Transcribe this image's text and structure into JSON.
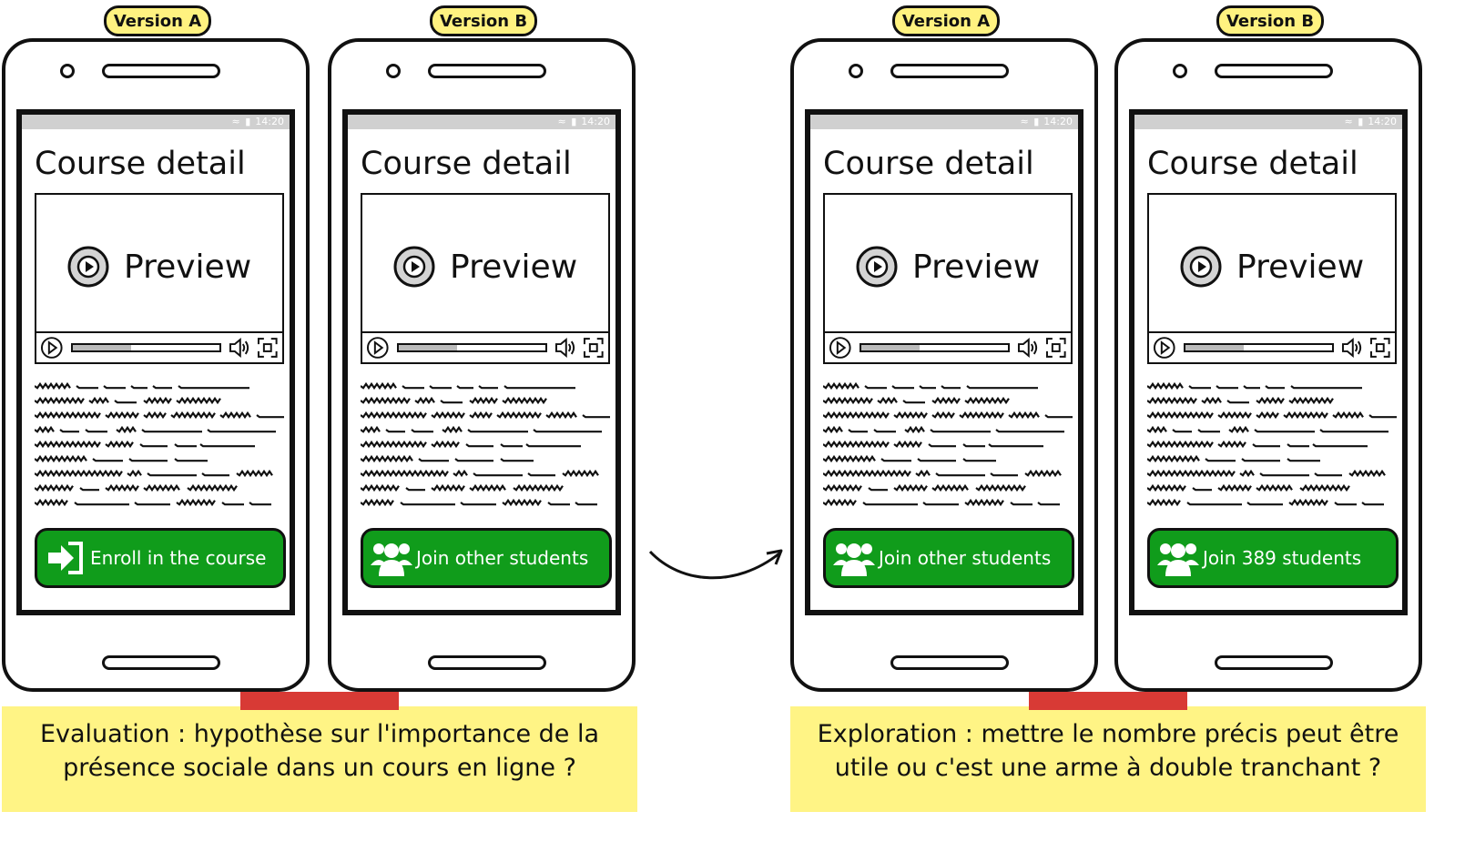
{
  "phones": [
    {
      "version_label": "Version A",
      "status_time": "14:20",
      "title": "Course detail",
      "preview_label": "Preview",
      "cta_label": "Enroll in the course",
      "cta_icon": "enroll-icon",
      "progress": 0.4
    },
    {
      "version_label": "Version B",
      "status_time": "14:20",
      "title": "Course detail",
      "preview_label": "Preview",
      "cta_label": "Join other students",
      "cta_icon": "group-icon",
      "progress": 0.4
    },
    {
      "version_label": "Version A",
      "status_time": "14:20",
      "title": "Course detail",
      "preview_label": "Preview",
      "cta_label": "Join other students",
      "cta_icon": "group-icon",
      "progress": 0.4
    },
    {
      "version_label": "Version B",
      "status_time": "14:20",
      "title": "Course detail",
      "preview_label": "Preview",
      "cta_label": "Join 389 students",
      "cta_icon": "group-icon",
      "progress": 0.4
    }
  ],
  "notes": [
    {
      "line1": "Evaluation : hypothèse sur l'importance de la",
      "line2": "présence sociale dans un cours en ligne ?"
    },
    {
      "line1": "Exploration : mettre le nombre précis peut être",
      "line2": "utile ou c'est une arme à double tranchant ?"
    }
  ],
  "colors": {
    "cta_green": "#109c1b",
    "note_yellow": "#fff485",
    "tag_yellow": "#fff280",
    "tape_red": "#d83a35"
  }
}
